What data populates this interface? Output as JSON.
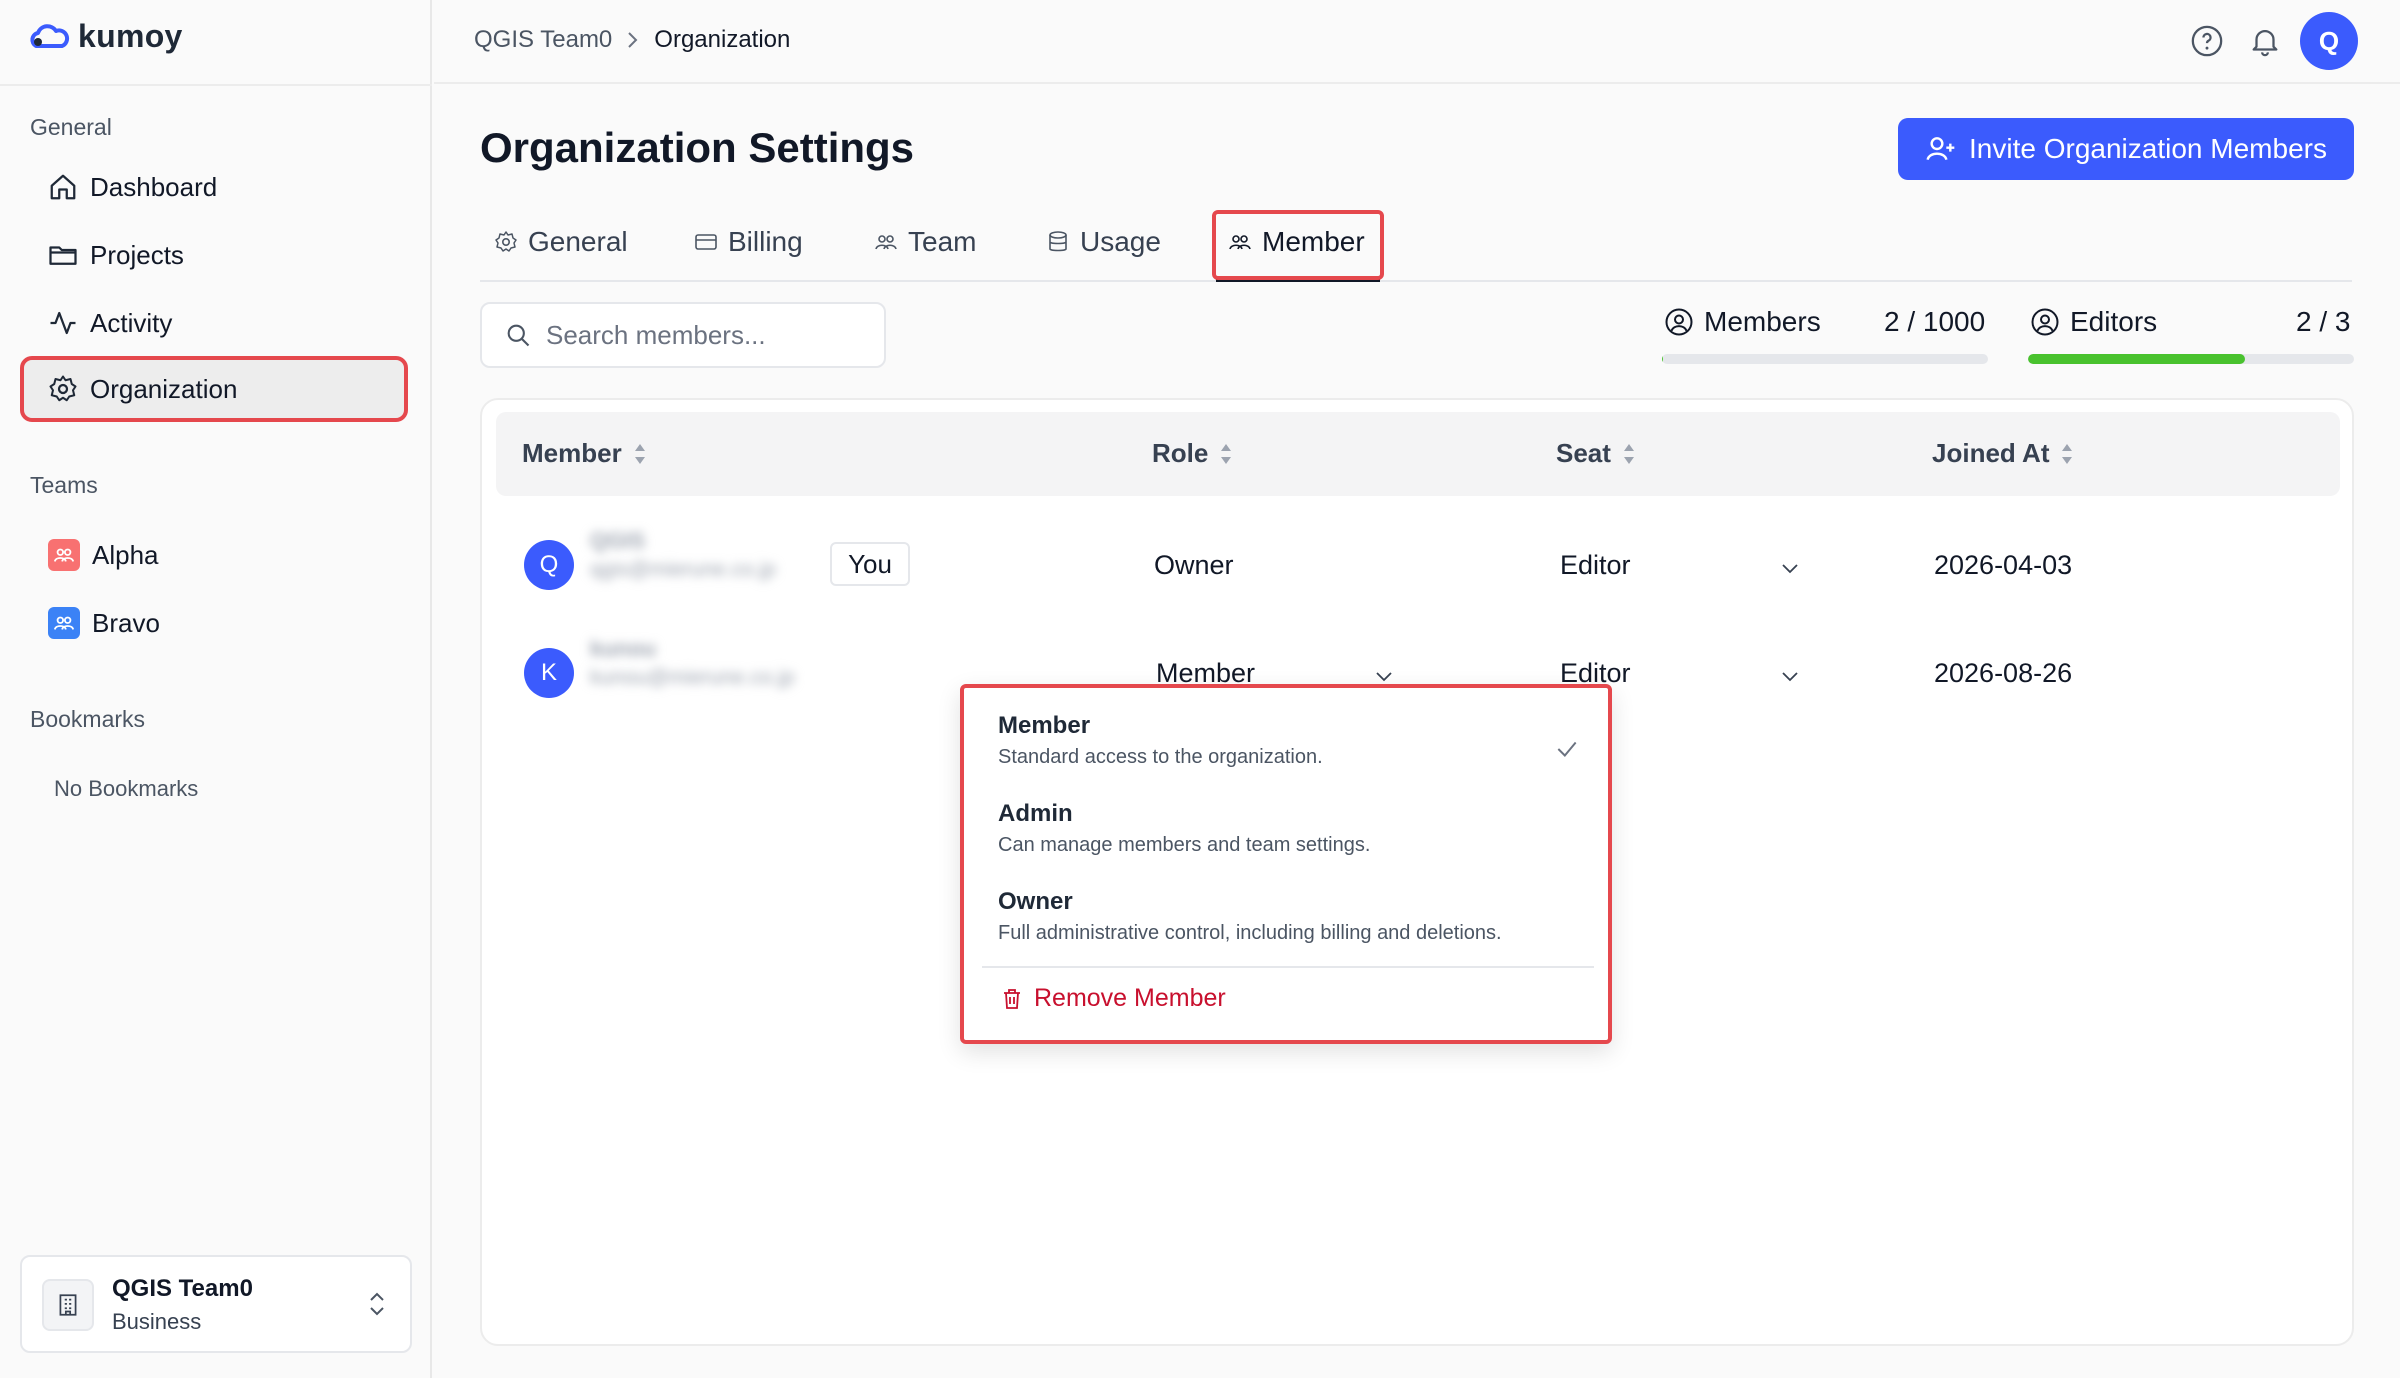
{
  "app": {
    "name": "kumoy"
  },
  "sidebar": {
    "general_label": "General",
    "nav": [
      {
        "label": "Dashboard",
        "icon": "home-icon"
      },
      {
        "label": "Projects",
        "icon": "folder-icon"
      },
      {
        "label": "Activity",
        "icon": "activity-icon"
      },
      {
        "label": "Organization",
        "icon": "gear-icon",
        "active": true
      }
    ],
    "teams_label": "Teams",
    "teams": [
      {
        "label": "Alpha",
        "color": "#f87171"
      },
      {
        "label": "Bravo",
        "color": "#3b82f6"
      }
    ],
    "bookmarks_label": "Bookmarks",
    "no_bookmarks": "No Bookmarks",
    "org_switcher": {
      "name": "QGIS Team0",
      "plan": "Business"
    }
  },
  "header": {
    "breadcrumb": [
      "QGIS Team0",
      "Organization"
    ],
    "avatar_initial": "Q"
  },
  "main": {
    "title": "Organization Settings",
    "invite_button": "Invite Organization Members",
    "tabs": [
      {
        "label": "General",
        "icon": "gear-icon"
      },
      {
        "label": "Billing",
        "icon": "card-icon"
      },
      {
        "label": "Team",
        "icon": "users-icon"
      },
      {
        "label": "Usage",
        "icon": "database-icon"
      },
      {
        "label": "Member",
        "icon": "users-icon",
        "active": true
      }
    ],
    "search": {
      "placeholder": "Search members..."
    },
    "stats": {
      "members_label": "Members",
      "members_value": "2 / 1000",
      "members_fraction": 0.002,
      "editors_label": "Editors",
      "editors_value": "2 / 3",
      "editors_fraction": 0.667,
      "bar_color": "#49c22e"
    },
    "table": {
      "columns": [
        "Member",
        "Role",
        "Seat",
        "Joined At"
      ],
      "rows": [
        {
          "initial": "Q",
          "name": "QGIS",
          "email": "qgis@mierune.co.jp",
          "you_badge": "You",
          "role": "Owner",
          "seat": "Editor",
          "joined": "2026-04-03"
        },
        {
          "initial": "K",
          "name": "kunou",
          "email": "kunou@mierune.co.jp",
          "role": "Member",
          "seat": "Editor",
          "joined": "2026-08-26"
        }
      ]
    },
    "role_dropdown": {
      "options": [
        {
          "title": "Member",
          "desc": "Standard access to the organization.",
          "selected": true
        },
        {
          "title": "Admin",
          "desc": "Can manage members and team settings."
        },
        {
          "title": "Owner",
          "desc": "Full administrative control, including billing and deletions."
        }
      ],
      "remove_label": "Remove Member"
    }
  },
  "colors": {
    "accent": "#3b5bfd",
    "highlight": "#e5484d",
    "danger": "#c8102e"
  }
}
